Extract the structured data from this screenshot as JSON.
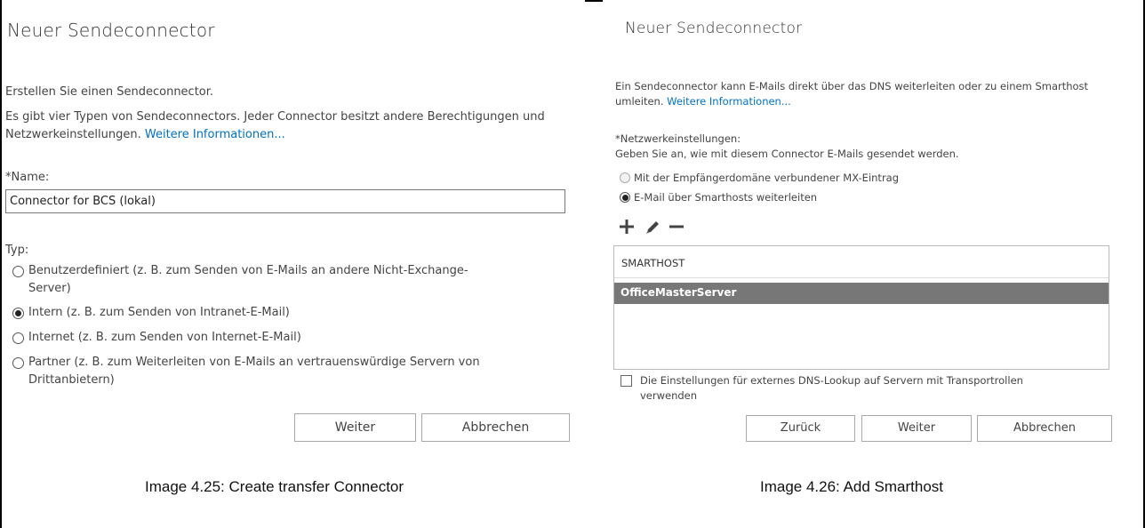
{
  "left": {
    "title": "Neuer Sendeconnector",
    "intro": "Erstellen Sie einen Sendeconnector.",
    "desc_line1": "Es gibt vier Typen von Sendeconnectors. Jeder Connector besitzt andere Berechtigungen und",
    "desc_line2": "Netzwerkeinstellungen.",
    "more_info": "Weitere Informationen...",
    "name_label": "*Name:",
    "name_value": "Connector for BCS (lokal)",
    "type_label": "Typ:",
    "options": [
      {
        "line1": "Benutzerdefiniert (z. B. zum Senden von E-Mails an andere Nicht-Exchange-",
        "line2": "Server)",
        "selected": false
      },
      {
        "line1": "Intern (z. B. zum Senden von Intranet-E-Mail)",
        "line2": "",
        "selected": true
      },
      {
        "line1": "Internet (z. B. zum Senden von Internet-E-Mail)",
        "line2": "",
        "selected": false
      },
      {
        "line1": "Partner (z. B. zum Weiterleiten von E-Mails an vertrauenswürdige Servern von",
        "line2": "Drittanbietern)",
        "selected": false
      }
    ],
    "next_button": "Weiter",
    "cancel_button": "Abbrechen"
  },
  "right": {
    "title": "Neuer Sendeconnector",
    "desc_line1": "Ein Sendeconnector kann E-Mails direkt über das DNS weiterleiten oder zu einem Smarthost",
    "desc_line2": "umleiten.",
    "more_info": "Weitere Informationen...",
    "net_label": "*Netzwerkeinstellungen:",
    "net_desc": "Geben Sie an, wie mit diesem Connector E-Mails gesendet werden.",
    "option_mx": "Mit der Empfängerdomäne verbundener MX-Eintrag",
    "option_smarthost": "E-Mail über Smarthosts weiterleiten",
    "list_header": "SMARTHOST",
    "list_items": [
      "OfficeMasterServer"
    ],
    "dns_checkbox_line1": "Die Einstellungen für externes DNS-Lookup auf Servern mit Transportrollen",
    "dns_checkbox_line2": "verwenden",
    "back_button": "Zurück",
    "next_button": "Weiter",
    "cancel_button": "Abbrechen",
    "icons": [
      "plus-icon",
      "pencil-icon",
      "minus-icon"
    ]
  },
  "captions": {
    "left": "Image 4.25: Create transfer Connector",
    "right": "Image 4.26: Add Smarthost"
  }
}
